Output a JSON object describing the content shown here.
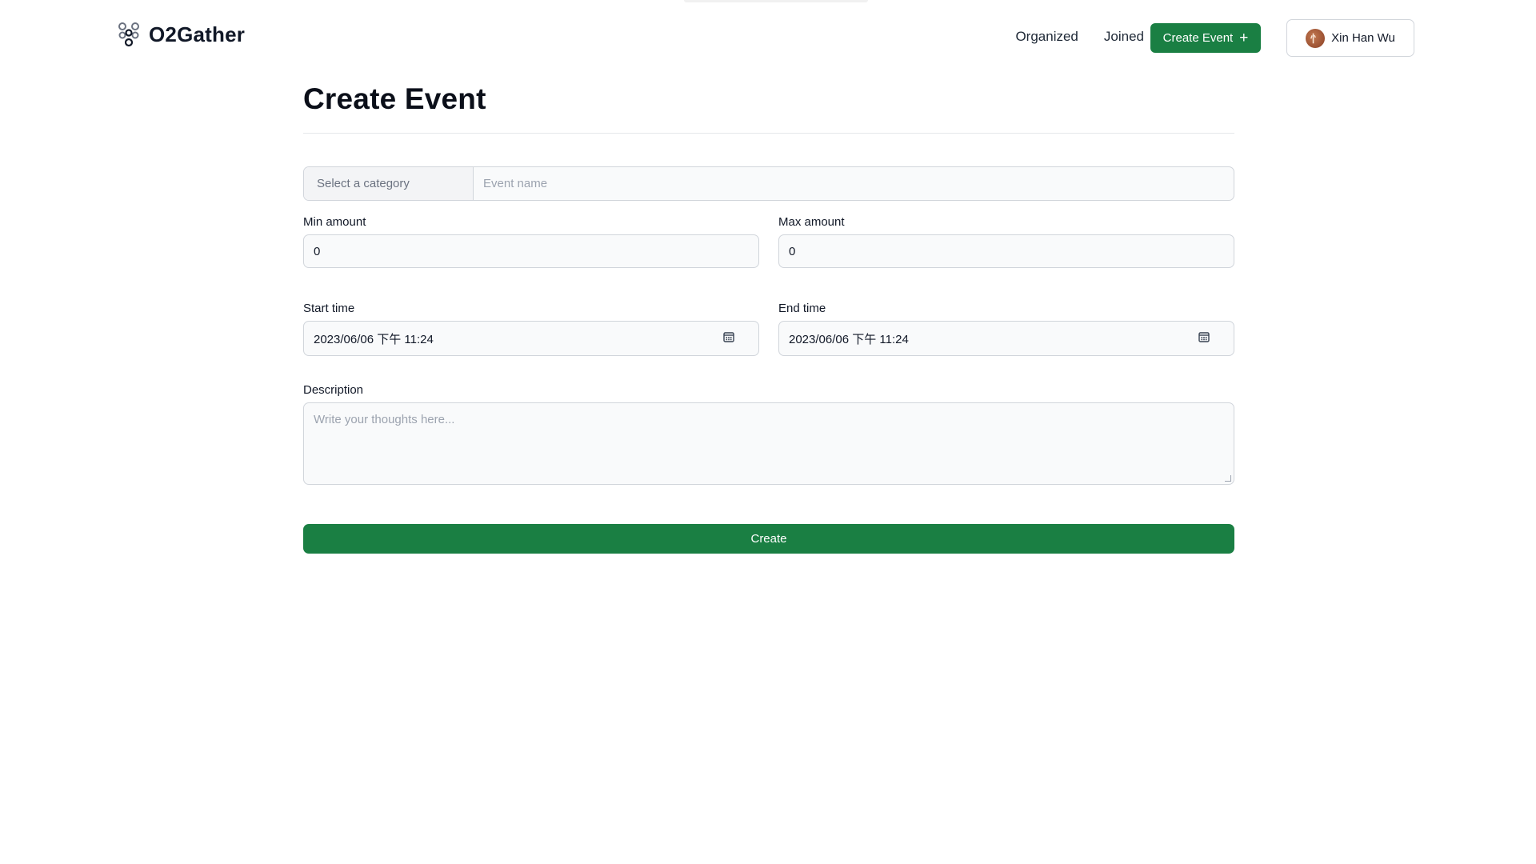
{
  "header": {
    "brand": "O2Gather",
    "nav": [
      "Organized",
      "Joined"
    ],
    "create_event_label": "Create Event",
    "user_name": "Xin Han Wu"
  },
  "main": {
    "title": "Create Event",
    "category_placeholder": "Select a category",
    "event_name_placeholder": "Event name",
    "min_amount_label": "Min amount",
    "min_amount_value": "0",
    "max_amount_label": "Max amount",
    "max_amount_value": "0",
    "start_time_label": "Start time",
    "start_time_value": "2023/06/06 下午 11:24",
    "end_time_label": "End time",
    "end_time_value": "2023/06/06 下午 11:24",
    "description_label": "Description",
    "description_placeholder": "Write your thoughts here...",
    "submit_label": "Create"
  },
  "colors": {
    "primary": "#1a7f43",
    "input_bg": "#f9fafb",
    "border": "#d1d5db"
  }
}
